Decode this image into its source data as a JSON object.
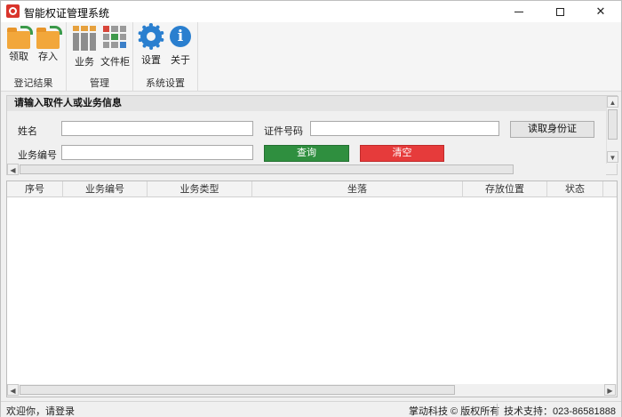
{
  "window": {
    "title": "智能权证管理系统"
  },
  "ribbon": {
    "groups": [
      {
        "label": "登记结果",
        "buttons": [
          {
            "label": "领取",
            "icon": "folder-export-icon"
          },
          {
            "label": "存入",
            "icon": "folder-import-icon"
          }
        ]
      },
      {
        "label": "管理",
        "buttons": [
          {
            "label": "业务",
            "icon": "business-grid-icon"
          },
          {
            "label": "文件柜",
            "icon": "file-cabinet-icon"
          }
        ]
      },
      {
        "label": "系统设置",
        "buttons": [
          {
            "label": "设置",
            "icon": "gear-icon"
          },
          {
            "label": "关于",
            "icon": "info-icon"
          }
        ]
      }
    ]
  },
  "search_panel": {
    "title": "请输入取件人或业务信息",
    "name_label": "姓名",
    "name_value": "",
    "id_label": "证件号码",
    "id_value": "",
    "read_id_button": "读取身份证",
    "biz_no_label": "业务编号",
    "biz_no_value": "",
    "query_button": "查询",
    "clear_button": "清空"
  },
  "table": {
    "columns": [
      "序号",
      "业务编号",
      "业务类型",
      "坐落",
      "存放位置",
      "状态"
    ],
    "rows": []
  },
  "statusbar": {
    "welcome": "欢迎你，请登录",
    "copyright": "掌动科技 © 版权所有",
    "support": "技术支持：023-86581888"
  },
  "colors": {
    "query_button": "#2f8f3f",
    "clear_button": "#e63b3b",
    "accent_blue": "#2a7fcf"
  }
}
